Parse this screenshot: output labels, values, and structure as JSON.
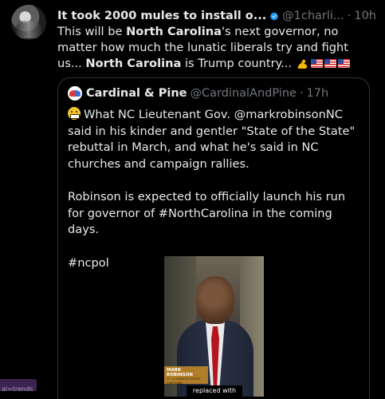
{
  "tweet": {
    "display_name": "It took 2000 mules to install o...",
    "handle": "@1charli...",
    "dot": "·",
    "time": "10h",
    "more": "···",
    "text": {
      "p1": "This will be ",
      "b1": "North Carolina",
      "p2": "'s next governor, no matter how much the lunatic liberals try and fight us... ",
      "b2": "North Carolina",
      "p3": " is Trump country... "
    }
  },
  "quote": {
    "display_name": "Cardinal & Pine",
    "handle": "@CardinalAndPine",
    "dot": "·",
    "time": "17h",
    "paragraph1": "What NC Lieutenant Gov. @markrobinsonNC said in his kinder and gentler \"State of the State\" rebuttal in March, and what he's said in NC churches and campaign rallies.",
    "paragraph2": "Robinson is expected to officially launch his run for governor of #NorthCarolina in the coming days.",
    "paragraph3": "#ncpol"
  },
  "video": {
    "lower_third_name": "MARK ROBINSON",
    "lower_third_sub": "LT. GOVERNOR NORTH CAROLINA",
    "caption": "replaced with"
  },
  "side_tab": {
    "label": "al=trends"
  },
  "colors": {
    "background": "#000000",
    "text": "#e7e9ea",
    "muted": "#71767b",
    "verified": "#1d9bf0",
    "border": "#2f3336"
  },
  "icons": [
    "verified-badge-icon",
    "flexed-biceps-emoji",
    "us-flag-emoji",
    "grimacing-face-emoji",
    "more-options-icon"
  ]
}
